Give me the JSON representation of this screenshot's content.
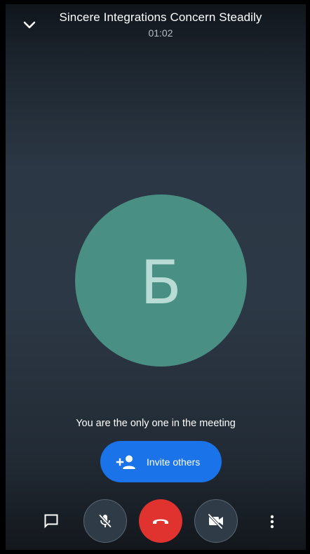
{
  "header": {
    "title": "Sincere Integrations Concern Steadily",
    "timer": "01:02",
    "collapse_icon": "chevron-down-icon"
  },
  "participant": {
    "avatar_initial": "Б",
    "avatar_color": "#4a8f83"
  },
  "status": {
    "message": "You are the only one in the meeting"
  },
  "invite": {
    "label": "Invite others",
    "icon": "person-add-icon",
    "color": "#1a73e8"
  },
  "controls": {
    "chat_icon": "chat-icon",
    "mic_icon": "mic-off-icon",
    "end_call_icon": "call-end-icon",
    "end_call_color": "#e0332f",
    "camera_icon": "videocam-off-icon",
    "more_icon": "more-vert-icon"
  }
}
